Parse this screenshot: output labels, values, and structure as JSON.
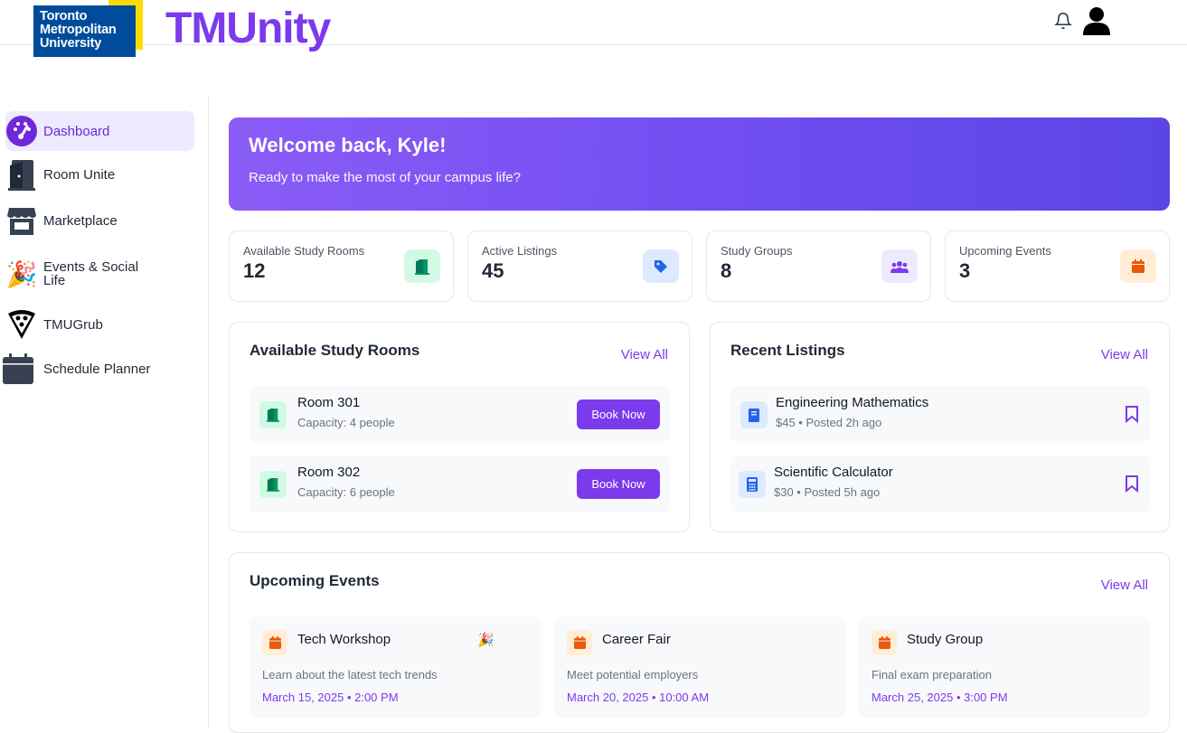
{
  "brand": {
    "logo_lines": [
      "Toronto",
      "Metropolitan",
      "University"
    ],
    "app_title": "TMUnity"
  },
  "header": {
    "notification_icon": "bell-icon",
    "profile_icon": "user-icon"
  },
  "sidebar": {
    "items": [
      {
        "label": "Dashboard",
        "icon": "speedometer-icon",
        "active": true
      },
      {
        "label": "Room Unite",
        "icon": "door-icon"
      },
      {
        "label": "Marketplace",
        "icon": "store-icon"
      },
      {
        "label": "Events & Social Life",
        "icon": "party-popper-icon"
      },
      {
        "label": "TMUGrub",
        "icon": "pizza-icon"
      },
      {
        "label": "Schedule Planner",
        "icon": "calendar-icon"
      }
    ]
  },
  "welcome": {
    "title": "Welcome back, Kyle!",
    "subtitle": "Ready to make the most of your campus life?"
  },
  "stats": [
    {
      "label": "Available Study Rooms",
      "value": "12",
      "icon": "door-icon",
      "color": "#10b981"
    },
    {
      "label": "Active Listings",
      "value": "45",
      "icon": "tag-icon",
      "color": "#2563eb"
    },
    {
      "label": "Study Groups",
      "value": "8",
      "icon": "users-icon",
      "color": "#7c3aed"
    },
    {
      "label": "Upcoming Events",
      "value": "3",
      "icon": "calendar-icon",
      "color": "#ea580c"
    }
  ],
  "study_rooms": {
    "title": "Available Study Rooms",
    "view_all": "View All",
    "rooms": [
      {
        "name": "Room 301",
        "capacity": "Capacity: 4 people",
        "button": "Book Now"
      },
      {
        "name": "Room 302",
        "capacity": "Capacity: 6 people",
        "button": "Book Now"
      }
    ]
  },
  "listings": {
    "title": "Recent Listings",
    "view_all": "View All",
    "items": [
      {
        "name": "Engineering Mathematics",
        "meta": "$45 • Posted 2h ago",
        "icon": "book-icon"
      },
      {
        "name": "Scientific Calculator",
        "meta": "$30 • Posted 5h ago",
        "icon": "calculator-icon"
      }
    ]
  },
  "events": {
    "title": "Upcoming Events",
    "view_all": "View All",
    "items": [
      {
        "name": "Tech Workshop",
        "desc": "Learn about the latest tech trends",
        "date": "March 15, 2025 • 2:00 PM",
        "emoji": "🎉"
      },
      {
        "name": "Career Fair",
        "desc": "Meet potential employers",
        "date": "March 20, 2025 • 10:00 AM"
      },
      {
        "name": "Study Group",
        "desc": "Final exam preparation",
        "date": "March 25, 2025 • 3:00 PM"
      }
    ]
  },
  "colors": {
    "accent": "#7c3aed",
    "brand_blue": "#004c9b",
    "brand_yellow": "#ffdc00"
  }
}
